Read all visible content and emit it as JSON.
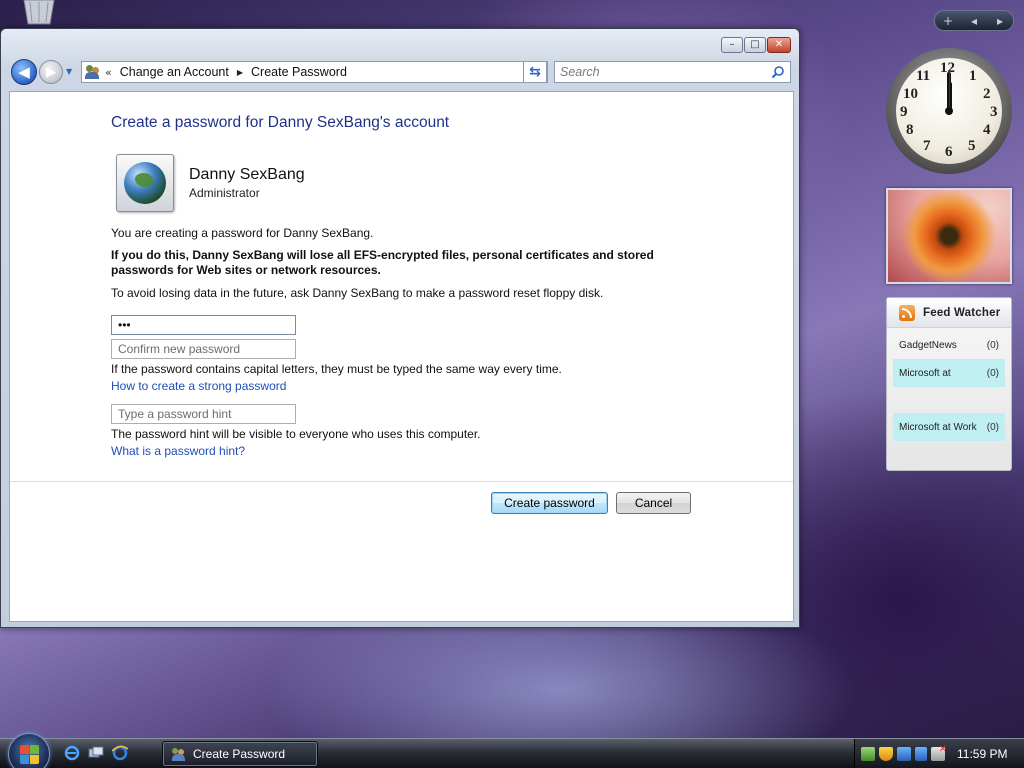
{
  "window": {
    "controls": {
      "minimize": "–",
      "maximize": "□",
      "close": "✕"
    }
  },
  "nav": {
    "back_glyph": "◀",
    "forward_glyph": "▶",
    "overflow": "«",
    "breadcrumbs": [
      "Change an Account",
      "Create Password"
    ],
    "search_placeholder": "Search"
  },
  "content": {
    "title": "Create a password for Danny SexBang's account",
    "account": {
      "name": "Danny SexBang",
      "role": "Administrator"
    },
    "intro": "You are creating a password for Danny SexBang.",
    "warning": "If you do this, Danny SexBang will lose all EFS-encrypted files, personal certificates and stored passwords for Web sites or network resources.",
    "advice": "To avoid losing data in the future, ask Danny SexBang to make a password reset floppy disk.",
    "password_value": "•••",
    "confirm_placeholder": "Confirm new password",
    "caps_note": "If the password contains capital letters, they must be typed the same way every time.",
    "strong_link": "How to create a strong password",
    "hint_placeholder": "Type a password hint",
    "hint_note": "The password hint will be visible to everyone who uses this computer.",
    "hint_link": "What is a password hint?",
    "create_button": "Create password",
    "cancel_button": "Cancel"
  },
  "sidebar": {
    "controls": [
      "+",
      "◂",
      "▸"
    ],
    "clock_numbers": [
      "12",
      "1",
      "2",
      "3",
      "4",
      "5",
      "6",
      "7",
      "8",
      "9",
      "10",
      "11"
    ],
    "feed": {
      "title": "Feed Watcher",
      "items": [
        {
          "name": "GadgetNews",
          "count": "(0)"
        },
        {
          "name": "Microsoft at",
          "count": "(0)"
        },
        {
          "name": "Microsoft at Work",
          "count": "(0)"
        }
      ]
    }
  },
  "taskbar": {
    "task_label": "Create Password",
    "time": "11:59 PM"
  },
  "colors": {
    "title_blue": "#1e3287",
    "link_blue": "#1f4fb8",
    "feed_highlight": "#bfeff2"
  }
}
